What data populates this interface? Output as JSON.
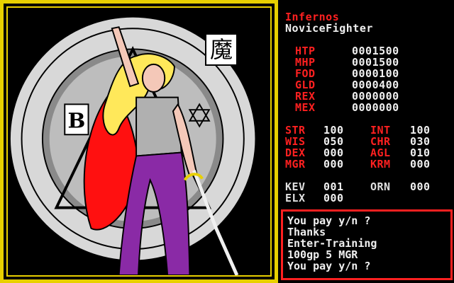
{
  "character": {
    "name": "Infernos",
    "class": "NoviceFighter"
  },
  "stats": [
    {
      "label": "HTP",
      "value": "0001500"
    },
    {
      "label": "MHP",
      "value": "0001500"
    },
    {
      "label": "FOD",
      "value": "0000100"
    },
    {
      "label": "GLD",
      "value": "0000400"
    },
    {
      "label": "REX",
      "value": "0000000"
    },
    {
      "label": "MEX",
      "value": "0000000"
    }
  ],
  "attributes": [
    {
      "label": "STR",
      "value": "100",
      "label2": "INT",
      "value2": "100"
    },
    {
      "label": "WIS",
      "value": "050",
      "label2": "CHR",
      "value2": "030"
    },
    {
      "label": "DEX",
      "value": "000",
      "label2": "AGL",
      "value2": "010"
    },
    {
      "label": "MGR",
      "value": "000",
      "label2": "KRM",
      "value2": "000"
    }
  ],
  "inventory": {
    "kev_label": "KEV",
    "kev_value": "001",
    "orn_label": "ORN",
    "orn_value": "000",
    "elx_label": "ELX",
    "elx_value": "000"
  },
  "messages": [
    "You pay y/n ?",
    "Thanks",
    "Enter-Training",
    "100gp 5 MGR",
    "You pay y/n ?"
  ],
  "art": {
    "kanji": "魔",
    "letter": "B"
  },
  "colors": {
    "frame": "#e8d000",
    "stat_label": "#ff2020",
    "text": "#f0f0f0"
  }
}
